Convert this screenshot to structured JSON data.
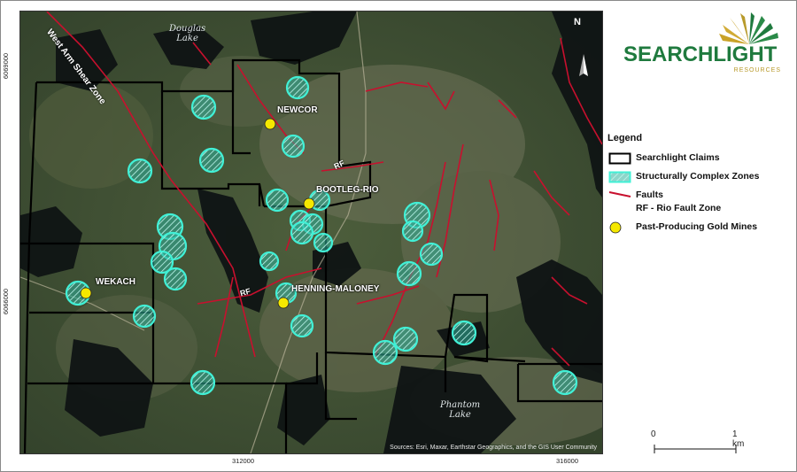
{
  "map": {
    "place_labels": {
      "douglas_lake": "Douglas\nLake",
      "phantom_lake": "Phantom\nLake"
    },
    "shear_zone_label": "West Arm Shear Zone",
    "rf_label": "RF",
    "mines": [
      {
        "name": "NEWCOR"
      },
      {
        "name": "BOOTLEG-RIO"
      },
      {
        "name": "WEKACH"
      },
      {
        "name": "HENNING-MALONEY"
      }
    ],
    "attribution": "Sources: Esri, Maxar, Earthstar Geographics, and the GIS User Community",
    "north_label": "N",
    "coords": {
      "y_top": "6069000",
      "y_bottom": "6066000",
      "x_left": "312000",
      "x_right": "316000"
    },
    "colors": {
      "claims": "#000000",
      "zones": "#3be8d0",
      "faults": "#c8102e",
      "mines": "#f5e800"
    }
  },
  "logo": {
    "main": "SEARCHLIGHT",
    "sub": "RESOURCES"
  },
  "legend": {
    "title": "Legend",
    "claims": "Searchlight Claims",
    "zones": "Structurally Complex Zones",
    "faults": "Faults",
    "rf": "RF - Rio Fault Zone",
    "mines": "Past-Producing Gold Mines"
  },
  "scale": {
    "zero": "0",
    "one": "1 km"
  }
}
